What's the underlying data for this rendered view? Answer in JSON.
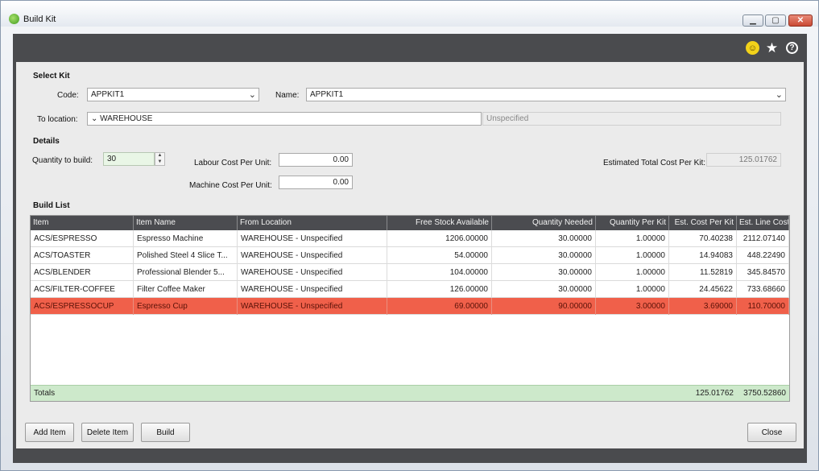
{
  "window": {
    "title": "Build Kit",
    "min": "▁",
    "max": "▢",
    "close": "✕"
  },
  "header_icons": {
    "smiley": "☺",
    "star": "★",
    "help": "?"
  },
  "select_kit": {
    "heading": "Select Kit",
    "code_label": "Code:",
    "code_value": "APPKIT1",
    "name_label": "Name:",
    "name_value": "APPKIT1",
    "to_location_label": "To location:",
    "to_location_value": "WAREHOUSE",
    "bin_value": "Unspecified"
  },
  "details": {
    "heading": "Details",
    "qty_label": "Quantity to build:",
    "qty_value": "30",
    "labour_label": "Labour Cost Per Unit:",
    "labour_value": "0.00",
    "machine_label": "Machine Cost Per Unit:",
    "machine_value": "0.00",
    "est_total_label": "Estimated Total Cost Per Kit:",
    "est_total_value": "125.01762"
  },
  "build_list": {
    "heading": "Build List",
    "columns": [
      "Item",
      "Item Name",
      "From Location",
      "Free Stock Available",
      "Quantity Needed",
      "Quantity Per Kit",
      "Est. Cost Per Kit",
      "Est. Line Cost"
    ],
    "rows": [
      [
        "ACS/ESPRESSO",
        "Espresso Machine",
        "WAREHOUSE - Unspecified",
        "1206.00000",
        "30.00000",
        "1.00000",
        "70.40238",
        "2112.07140"
      ],
      [
        "ACS/TOASTER",
        "Polished Steel 4 Slice T...",
        "WAREHOUSE - Unspecified",
        "54.00000",
        "30.00000",
        "1.00000",
        "14.94083",
        "448.22490"
      ],
      [
        "ACS/BLENDER",
        "Professional Blender 5...",
        "WAREHOUSE - Unspecified",
        "104.00000",
        "30.00000",
        "1.00000",
        "11.52819",
        "345.84570"
      ],
      [
        "ACS/FILTER-COFFEE",
        "Filter Coffee Maker",
        "WAREHOUSE - Unspecified",
        "126.00000",
        "30.00000",
        "1.00000",
        "24.45622",
        "733.68660"
      ],
      [
        "ACS/ESPRESSOCUP",
        "Espresso Cup",
        "WAREHOUSE - Unspecified",
        "69.00000",
        "90.00000",
        "3.00000",
        "3.69000",
        "110.70000"
      ]
    ],
    "totals_label": "Totals",
    "totals_cost_per_kit": "125.01762",
    "totals_line_cost": "3750.52860",
    "error_row_color": "#f0604a"
  },
  "buttons": {
    "add_item": "Add Item",
    "delete_item": "Delete Item",
    "build": "Build",
    "close": "Close"
  }
}
